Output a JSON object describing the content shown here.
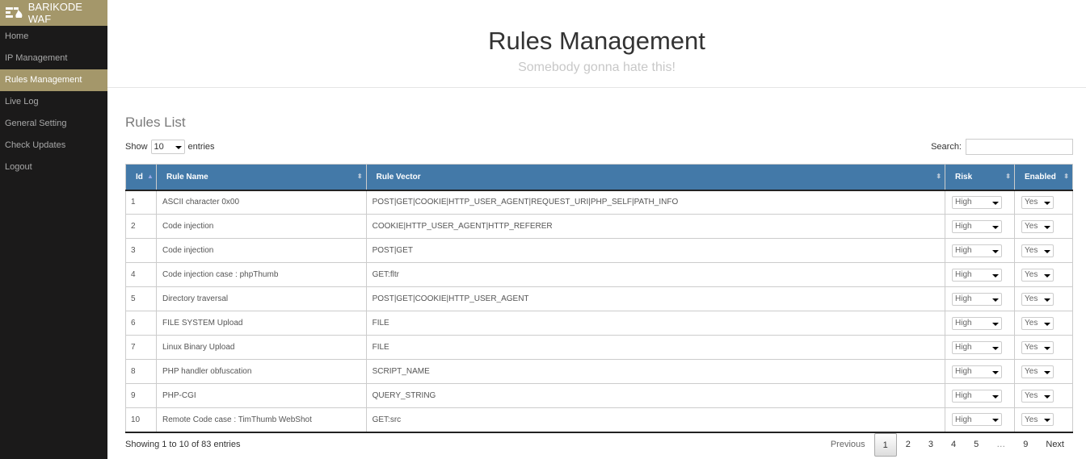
{
  "brand": {
    "name": "BARIKODE WAF",
    "logo": "barikode-logo"
  },
  "sidebar": {
    "items": [
      {
        "label": "Home"
      },
      {
        "label": "IP Management"
      },
      {
        "label": "Rules Management",
        "active": true
      },
      {
        "label": "Live Log"
      },
      {
        "label": "General Setting"
      },
      {
        "label": "Check Updates"
      },
      {
        "label": "Logout"
      }
    ]
  },
  "header": {
    "title": "Rules Management",
    "subtitle": "Somebody gonna hate this!"
  },
  "section_title": "Rules List",
  "length": {
    "show": "Show",
    "value": "10",
    "entries": "entries"
  },
  "search": {
    "label": "Search:",
    "value": ""
  },
  "table": {
    "columns": [
      "Id",
      "Rule Name",
      "Rule Vector",
      "Risk",
      "Enabled"
    ],
    "rows": [
      [
        "1",
        "ASCII character 0x00",
        "POST|GET|COOKIE|HTTP_USER_AGENT|REQUEST_URI|PHP_SELF|PATH_INFO",
        "High",
        "Yes"
      ],
      [
        "2",
        "Code injection",
        "COOKIE|HTTP_USER_AGENT|HTTP_REFERER",
        "High",
        "Yes"
      ],
      [
        "3",
        "Code injection",
        "POST|GET",
        "High",
        "Yes"
      ],
      [
        "4",
        "Code injection case : phpThumb",
        "GET:fltr",
        "High",
        "Yes"
      ],
      [
        "5",
        "Directory traversal",
        "POST|GET|COOKIE|HTTP_USER_AGENT",
        "High",
        "Yes"
      ],
      [
        "6",
        "FILE SYSTEM Upload",
        "FILE",
        "High",
        "Yes"
      ],
      [
        "7",
        "Linux Binary Upload",
        "FILE",
        "High",
        "Yes"
      ],
      [
        "8",
        "PHP handler obfuscation",
        "SCRIPT_NAME",
        "High",
        "Yes"
      ],
      [
        "9",
        "PHP-CGI",
        "QUERY_STRING",
        "High",
        "Yes"
      ],
      [
        "10",
        "Remote Code case : TimThumb WebShot",
        "GET:src",
        "High",
        "Yes"
      ]
    ]
  },
  "info": "Showing 1 to 10 of 83 entries",
  "pagination": {
    "previous": "Previous",
    "pages": [
      "1",
      "2",
      "3",
      "4",
      "5",
      "…",
      "9"
    ],
    "current": "1",
    "next": "Next"
  },
  "colors": {
    "sidebar": "#1b1a1a",
    "accent": "#a4976a",
    "table_header": "#4379a8"
  }
}
